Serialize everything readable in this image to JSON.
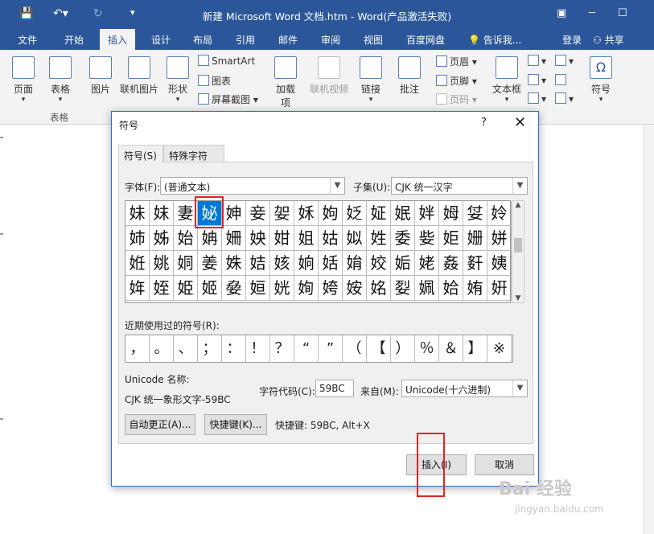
{
  "app": {
    "title": "新建 Microsoft Word 文档.htm - Word(产品激活失败)",
    "login": "登录",
    "share": "共享",
    "tell_me": "告诉我..."
  },
  "menu_tabs": [
    {
      "label": "文件"
    },
    {
      "label": "开始"
    },
    {
      "label": "插入",
      "active": true
    },
    {
      "label": "设计"
    },
    {
      "label": "布局"
    },
    {
      "label": "引用"
    },
    {
      "label": "邮件"
    },
    {
      "label": "审阅"
    },
    {
      "label": "视图"
    },
    {
      "label": "百度网盘"
    }
  ],
  "ribbon": {
    "page": "页面",
    "table": "表格",
    "picture": "图片",
    "online_picture": "联机图片",
    "shapes": "形状",
    "smartart": "SmartArt",
    "chart": "图表",
    "screenshot": "屏幕截图",
    "addins": "加载项",
    "online_video": "联机视频",
    "link": "链接",
    "comment": "批注",
    "header": "页眉",
    "footer": "页脚",
    "page_number": "页码",
    "textbox": "文本框",
    "symbol": "符号",
    "group_table": "表格"
  },
  "dialog": {
    "title": "符号",
    "help": "?",
    "close": "✕",
    "tab_symbols": "符号(S)",
    "tab_special": "特殊字符(P)",
    "font_label": "字体(F):",
    "font_value": "(普通文本)",
    "subset_label": "子集(U):",
    "subset_value": "CJK 统一汉字",
    "symbols": [
      [
        "妹",
        "妺",
        "妻",
        "妼",
        "妽",
        "妾",
        "妿",
        "姀",
        "姁",
        "姂",
        "姃",
        "姄",
        "姅",
        "姆",
        "姇",
        "姈"
      ],
      [
        "姉",
        "姊",
        "始",
        "姌",
        "姍",
        "姎",
        "姏",
        "姐",
        "姑",
        "姒",
        "姓",
        "委",
        "姕",
        "姖",
        "姗",
        "姘"
      ],
      [
        "姙",
        "姚",
        "姛",
        "姜",
        "姝",
        "姞",
        "姟",
        "姠",
        "姡",
        "姢",
        "姣",
        "姤",
        "姥",
        "姦",
        "姧",
        "姨"
      ],
      [
        "姩",
        "姪",
        "姫",
        "姬",
        "姭",
        "姮",
        "姯",
        "姰",
        "姱",
        "姲",
        "姳",
        "姴",
        "姵",
        "姶",
        "姷",
        "姸"
      ]
    ],
    "recent_label": "近期使用过的符号(R):",
    "recent": [
      "，",
      "。",
      "、",
      "；",
      "：",
      "！",
      "？",
      "“",
      "”",
      "（",
      "【",
      "）",
      "％",
      "＆",
      "】",
      "※"
    ],
    "unicode_name_label": "Unicode 名称:",
    "unicode_name": "CJK 统一象形文字-59BC",
    "char_code_label": "字符代码(C):",
    "char_code": "59BC",
    "from_label": "来自(M):",
    "from_value": "Unicode(十六进制)",
    "autocorrect_btn": "自动更正(A)...",
    "shortcut_btn": "快捷键(K)...",
    "shortcut_text": "快捷键: 59BC, Alt+X",
    "insert_btn": "插入(I)",
    "cancel_btn": "取消"
  },
  "watermark": {
    "brand": "Bai 经验",
    "url": "jingyan.baidu.com"
  },
  "colors": {
    "accent": "#2b579a",
    "selection": "#0078d7",
    "highlight": "#e32222"
  }
}
